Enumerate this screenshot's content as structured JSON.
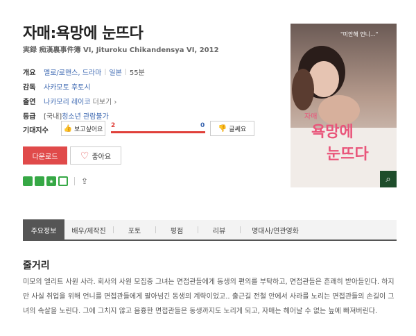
{
  "movie": {
    "title": "자매:욕망에 눈뜨다",
    "subtitle": "実録 痴漢裏事件簿 VI, Jituroku Chikandensya VI, 2012"
  },
  "info": {
    "genre_label": "개요",
    "genre": "멜로/로맨스, 드라마",
    "country": "일본",
    "runtime": "55분",
    "director_label": "감독",
    "director": "사카모토 후토시",
    "cast_label": "출연",
    "cast": "나카모리 레이코",
    "cast_more": "더보기 ›",
    "rating_label": "등급",
    "rating_prefix": "[국내]",
    "rating": "청소년 관람불가"
  },
  "expectation": {
    "label": "기대지수",
    "want_label": "보고싶어요",
    "want_count": "2",
    "no_count": "0",
    "no_label": "글쎄요",
    "want_ratio": 1.0
  },
  "actions": {
    "download_label": "다운로드",
    "like_label": "좋아요"
  },
  "badges": {
    "b1": "",
    "b2": "",
    "b3": "★",
    "b4": ""
  },
  "poster": {
    "caption": "\"미안해 언니...\"",
    "title_small": "자매",
    "title_line1": "욕망에",
    "title_line2": "눈뜨다"
  },
  "tabs": [
    {
      "label": "주요정보"
    },
    {
      "label": "배우/제작진"
    },
    {
      "label": "포토"
    },
    {
      "label": "평점"
    },
    {
      "label": "리뷰"
    },
    {
      "label": "명대사/연관영화"
    }
  ],
  "synopsis": {
    "heading": "줄거리",
    "text": "미모의 엘리트 사원 사라. 회사의 사원 모집중 그녀는 면접관들에게 동생의 편의를 부탁하고, 면접관들은 흔쾌히 받아들인다. 하지만 사실 취업을 위해 언니를 면접관들에게 팔아넘긴 동생의 계략이었고.. 출근길 전철 안에서 사라를 노리는 면접관들의 손길이 그녀의 속살을 노린다. 그에 그치지 않고 음흉한 면접관들은 동생까지도 노리게 되고, 자매는 헤어날 수 없는 늪에 빠져버린다."
  }
}
